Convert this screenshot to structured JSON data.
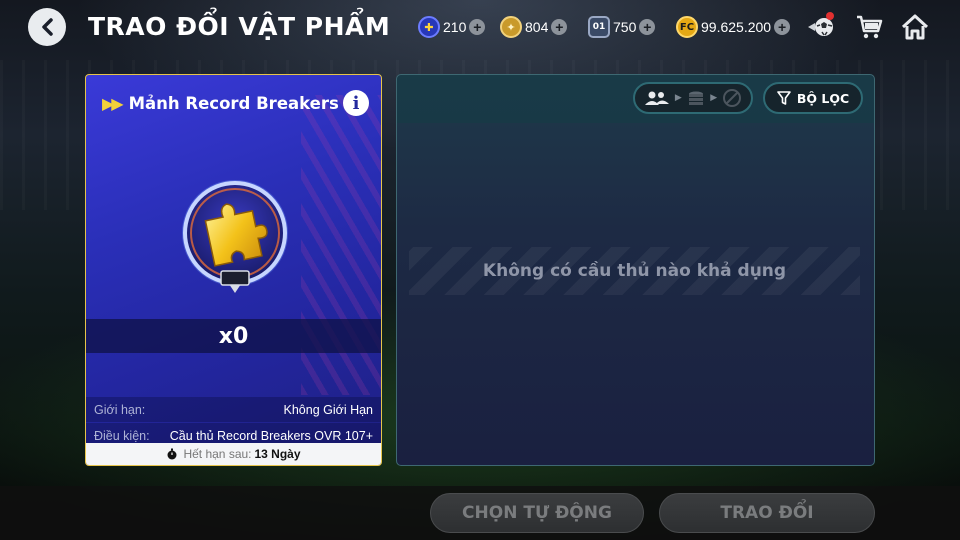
{
  "header": {
    "back_icon": "chevron-left-icon",
    "title": "TRAO ĐỔI VẬT PHẨM",
    "currencies": [
      {
        "name": "puzzle-token",
        "icon": "puzzle-icon",
        "value": "210"
      },
      {
        "name": "gold-coin",
        "icon": "coin-icon",
        "value": "804"
      },
      {
        "name": "card-token",
        "icon": "card-icon",
        "value": "750"
      },
      {
        "name": "fc-coin",
        "icon": "fc-coin-icon",
        "value": "99.625.200"
      }
    ],
    "icons": [
      "ball-shop-icon",
      "cart-icon",
      "home-icon"
    ]
  },
  "item_card": {
    "title": "Mảnh Record Breakers",
    "quantity": "x0",
    "rows": [
      {
        "label": "Giới hạn:",
        "value": "Không Giới Hạn"
      },
      {
        "label": "Điều kiện:",
        "value": "Cầu thủ Record Breakers OVR 107+"
      }
    ],
    "expiry_label": "Hết hạn sau:",
    "expiry_value": "13 Ngày",
    "colors": {
      "border": "#e6c44a",
      "background": "#2a2fb8"
    }
  },
  "list_panel": {
    "filter_label": "BỘ LỌC",
    "empty_message": "Không có cầu thủ nào khả dụng"
  },
  "actions": {
    "auto_select_label": "CHỌN TỰ ĐỘNG",
    "exchange_label": "TRAO ĐỔI"
  }
}
